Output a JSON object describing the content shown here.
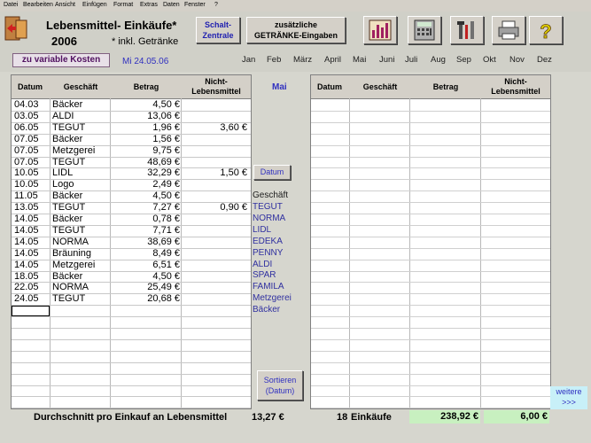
{
  "menu": [
    "Datei",
    "Bearbeiten",
    "Ansicht",
    "Einfügen",
    "Format",
    "Extras",
    "Daten",
    "Fenster",
    "?"
  ],
  "header": {
    "title_line1": "Lebensmittel- Einkäufe*",
    "title_line2": "2006",
    "incl_note": "* inkl. Getränke",
    "schalt_line1": "Schalt-",
    "schalt_line2": "Zentrale",
    "getraenke_line1": "zusätzliche",
    "getraenke_line2": "GETRÄNKE-Eingaben",
    "zu_variable": "zu variable Kosten",
    "date": "Mi  24.05.06"
  },
  "months": [
    "Jan",
    "Feb",
    "März",
    "April",
    "Mai",
    "Juni",
    "Juli",
    "Aug",
    "Sep",
    "Okt",
    "Nov",
    "Dez"
  ],
  "table_left": {
    "headers": {
      "datum": "Datum",
      "geschaeft": "Geschäft",
      "betrag": "Betrag",
      "nicht1": "Nicht-",
      "nicht2": "Lebensmittel"
    },
    "rows": [
      {
        "datum": "04.03",
        "geschaeft": "Bäcker",
        "betrag": "4,50 €",
        "nicht": ""
      },
      {
        "datum": "03.05",
        "geschaeft": "ALDI",
        "betrag": "13,06 €",
        "nicht": ""
      },
      {
        "datum": "06.05",
        "geschaeft": "TEGUT",
        "betrag": "1,96 €",
        "nicht": "3,60 €"
      },
      {
        "datum": "07.05",
        "geschaeft": "Bäcker",
        "betrag": "1,56 €",
        "nicht": ""
      },
      {
        "datum": "07.05",
        "geschaeft": "Metzgerei",
        "betrag": "9,75 €",
        "nicht": ""
      },
      {
        "datum": "07.05",
        "geschaeft": "TEGUT",
        "betrag": "48,69 €",
        "nicht": ""
      },
      {
        "datum": "10.05",
        "geschaeft": "LIDL",
        "betrag": "32,29 €",
        "nicht": "1,50 €"
      },
      {
        "datum": "10.05",
        "geschaeft": "Logo",
        "betrag": "2,49 €",
        "nicht": ""
      },
      {
        "datum": "11.05",
        "geschaeft": "Bäcker",
        "betrag": "4,50 €",
        "nicht": ""
      },
      {
        "datum": "13.05",
        "geschaeft": "TEGUT",
        "betrag": "7,27 €",
        "nicht": "0,90 €"
      },
      {
        "datum": "14.05",
        "geschaeft": "Bäcker",
        "betrag": "0,78 €",
        "nicht": ""
      },
      {
        "datum": "14.05",
        "geschaeft": "TEGUT",
        "betrag": "7,71 €",
        "nicht": ""
      },
      {
        "datum": "14.05",
        "geschaeft": "NORMA",
        "betrag": "38,69 €",
        "nicht": ""
      },
      {
        "datum": "14.05",
        "geschaeft": "Bräuning",
        "betrag": "8,49 €",
        "nicht": ""
      },
      {
        "datum": "14.05",
        "geschaeft": "Metzgerei",
        "betrag": "6,51 €",
        "nicht": ""
      },
      {
        "datum": "18.05",
        "geschaeft": "Bäcker",
        "betrag": "4,50 €",
        "nicht": ""
      },
      {
        "datum": "22.05",
        "geschaeft": "NORMA",
        "betrag": "25,49 €",
        "nicht": ""
      },
      {
        "datum": "24.05",
        "geschaeft": "TEGUT",
        "betrag": "20,68 €",
        "nicht": ""
      }
    ]
  },
  "middle": {
    "month_label": "Mai",
    "datum_button": "Datum",
    "geschaeft_label": "Geschäft",
    "shops": [
      "TEGUT",
      "NORMA",
      "LIDL",
      "EDEKA",
      "PENNY",
      "ALDI",
      "SPAR",
      "FAMILA",
      "Metzgerei",
      "Bäcker"
    ],
    "sortieren_line1": "Sortieren",
    "sortieren_line2": "(Datum)"
  },
  "table_right": {
    "headers": {
      "datum": "Datum",
      "geschaeft": "Geschäft",
      "betrag": "Betrag",
      "nicht1": "Nicht-",
      "nicht2": "Lebensmittel"
    }
  },
  "weitere": {
    "line1": "weitere",
    "line2": ">>>"
  },
  "footer": {
    "avg_label": "Durchschnitt pro Einkauf an Lebensmittel",
    "avg_value": "13,27 €",
    "count": "18",
    "count_label": "Einkäufe",
    "total": "238,92 €",
    "total_nicht": "6,00 €"
  },
  "colors": {
    "accent": "#3030c0",
    "green": "#c8f0c0",
    "cyan": "#c8f0f8"
  }
}
